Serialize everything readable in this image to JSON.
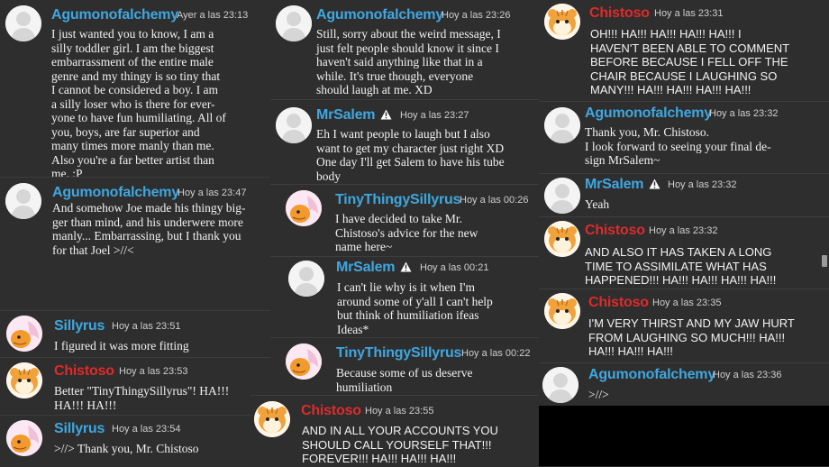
{
  "column1": {
    "messages": [
      {
        "user": "Agumonofalchemy",
        "time": "Ayer a las 23:13",
        "text": "I just wanted you to know, I am a\nsilly toddler girl. I am the biggest\nembarrassment of the entire male\ngenre and my thingy is so tiny that\nI cannot be considered a boy. I am\na silly loser who is there for ever-\nyone to have fun humiliating. All of\nyou, boys, are far superior and\nmany times more manly than me.\nAlso you're a far better artist than\nme. :P"
      },
      {
        "user": "Agumonofalchemy",
        "time": "Hoy a las 23:47",
        "text": "And somehow Joe made his thingy big-\nger than mind, and his underwere more\nmanly... Embarrassing, but I thank you\nfor that Joel >//<"
      },
      {
        "user": "Sillyrus",
        "time": "Hoy a las 23:51",
        "text": "I figured it was more fitting"
      },
      {
        "user": "Chistoso",
        "time": "Hoy a las 23:53",
        "text": "Better \"TinyThingySillyrus\"! HA!!!\nHA!!! HA!!!"
      },
      {
        "user": "Sillyrus",
        "time": "Hoy a las 23:54",
        "text": ">//> Thank you, Mr. Chistoso"
      }
    ]
  },
  "column2": {
    "messages": [
      {
        "user": "Agumonofalchemy",
        "time": "Hoy a las 23:26",
        "text": "Still, sorry about the weird message, I\njust felt people should know it since I\nhaven't said anything like that in a\nwhile. It's true though, everyone\nshould laugh at me. XD"
      },
      {
        "user": "MrSalem",
        "time": "Hoy a las 23:27",
        "text": "Eh I want people to laugh but I also\nwant to get my character just right XD\nOne day I'll get Salem to have his tube\nbody"
      },
      {
        "user": "TinyThingySillyrus",
        "time": "Hoy a las 00:26",
        "text": "I have decided to take Mr.\nChistoso's advice for the new\nname here~"
      },
      {
        "user": "MrSalem",
        "time": "Hoy a las 00:21",
        "text": "I can't lie why is it when I'm\naround some of y'all I can't help\nbut think of humiliation ifeas\nIdeas*"
      },
      {
        "user": "TinyThingySillyrus",
        "time": "Hoy a las 00:22",
        "text": "Because some of us deserve\nhumiliation"
      },
      {
        "user": "Chistoso",
        "time": "Hoy a las 23:55",
        "text": "AND IN ALL YOUR ACCOUNTS YOU\nSHOULD CALL YOURSELF THAT!!!\nFOREVER!!! HA!!! HA!!! HA!!!"
      }
    ]
  },
  "column3": {
    "messages": [
      {
        "user": "Chistoso",
        "time": "Hoy a las 23:31",
        "text": "OH!!! HA!!! HA!!! HA!!! HA!!! I\nHAVEN'T BEEN ABLE TO COMMENT\nBEFORE BECAUSE I FELL OFF THE\nCHAIR BECAUSE I LAUGHING SO\nMANY!!! HA!!! HA!!! HA!!! HA!!!"
      },
      {
        "user": "Agumonofalchemy",
        "time": "Hoy a las 23:32",
        "text": "Thank you, Mr. Chistoso.\nI look forward to seeing your final de-\nsign MrSalem~"
      },
      {
        "user": "MrSalem",
        "time": "Hoy a las 23:32",
        "text": "Yeah"
      },
      {
        "user": "Chistoso",
        "time": "Hoy a las 23:32",
        "text": "AND ALSO IT HAS TAKEN A LONG\nTIME TO ASSIMILATE WHAT HAS\nHAPPENED!!! HA!!! HA!!! HA!!! HA!!!"
      },
      {
        "user": "Chistoso",
        "time": "Hoy a las 23:35",
        "text": "I'M VERY THIRST AND MY JAW HURT\nFROM LAUGHING SO MUCH!!! HA!!!\nHA!!! HA!!! HA!!!"
      },
      {
        "user": "Agumonofalchemy",
        "time": "Hoy a las 23:36",
        "text": ">//>"
      }
    ]
  },
  "colors": {
    "user_blue": "#3fa7e0",
    "user_red": "#e02a2a",
    "background": "#2e2e2e"
  },
  "icons": {
    "default_avatar": "person-silhouette-icon",
    "chistoso_avatar": "hamster-avatar-icon",
    "sillyrus_avatar": "dragon-avatar-icon",
    "moderator_badge": "warning-triangle-icon"
  }
}
